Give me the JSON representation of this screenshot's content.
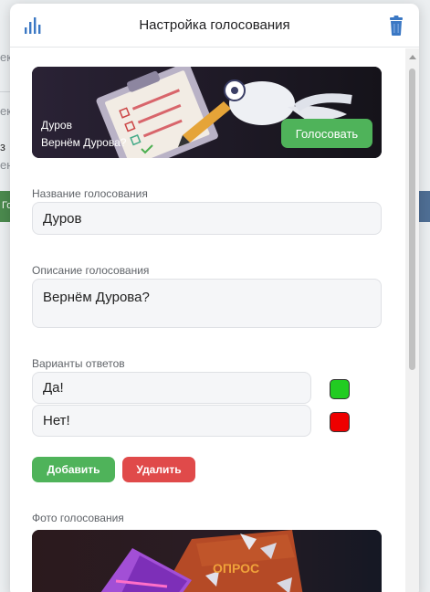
{
  "background": {
    "fragments": [
      "ек",
      "ек",
      "з",
      "ен",
      "Го"
    ]
  },
  "modal": {
    "title": "Настройка голосования",
    "header_left_icon": "bar-chart-icon",
    "header_right_icon": "trash-icon"
  },
  "banner": {
    "name": "Дуров",
    "description": "Вернём Дурова?",
    "vote_label": "Голосовать"
  },
  "form": {
    "name_label": "Название голосования",
    "name_value": "Дуров",
    "description_label": "Описание голосования",
    "description_value": "Вернём Дурова?",
    "options_label": "Варианты ответов",
    "options": [
      {
        "text": "Да!",
        "color": "#22cc22"
      },
      {
        "text": "Нет!",
        "color": "#ee0000"
      }
    ],
    "add_label": "Добавить",
    "delete_label": "Удалить",
    "photo_label": "Фото голосования"
  },
  "photo": {
    "caption": "ОПРОС"
  },
  "colors": {
    "primary_green": "#4fb35a",
    "danger_red": "#e04a4a",
    "icon_blue": "#3b78c4"
  }
}
